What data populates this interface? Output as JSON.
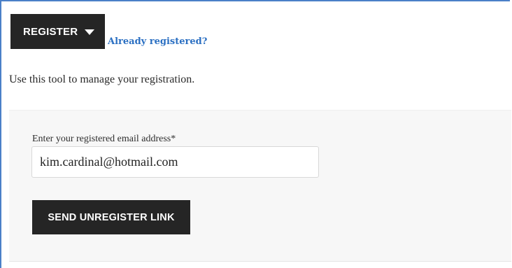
{
  "header": {
    "register_label": "REGISTER",
    "already_registered_link": "Already registered?"
  },
  "intro": {
    "text": "Use this tool to manage your registration."
  },
  "form": {
    "email_label": "Enter your registered email address*",
    "email_value": "kim.cardinal@hotmail.com",
    "submit_label": "SEND UNREGISTER LINK"
  },
  "icons": {
    "register_dropdown": "caret-down-icon"
  },
  "colors": {
    "button_bg": "#252525",
    "button_text": "#ffffff",
    "link": "#2a6fc2",
    "panel_bg": "#f7f7f7",
    "frame_border": "#4a80c8"
  }
}
